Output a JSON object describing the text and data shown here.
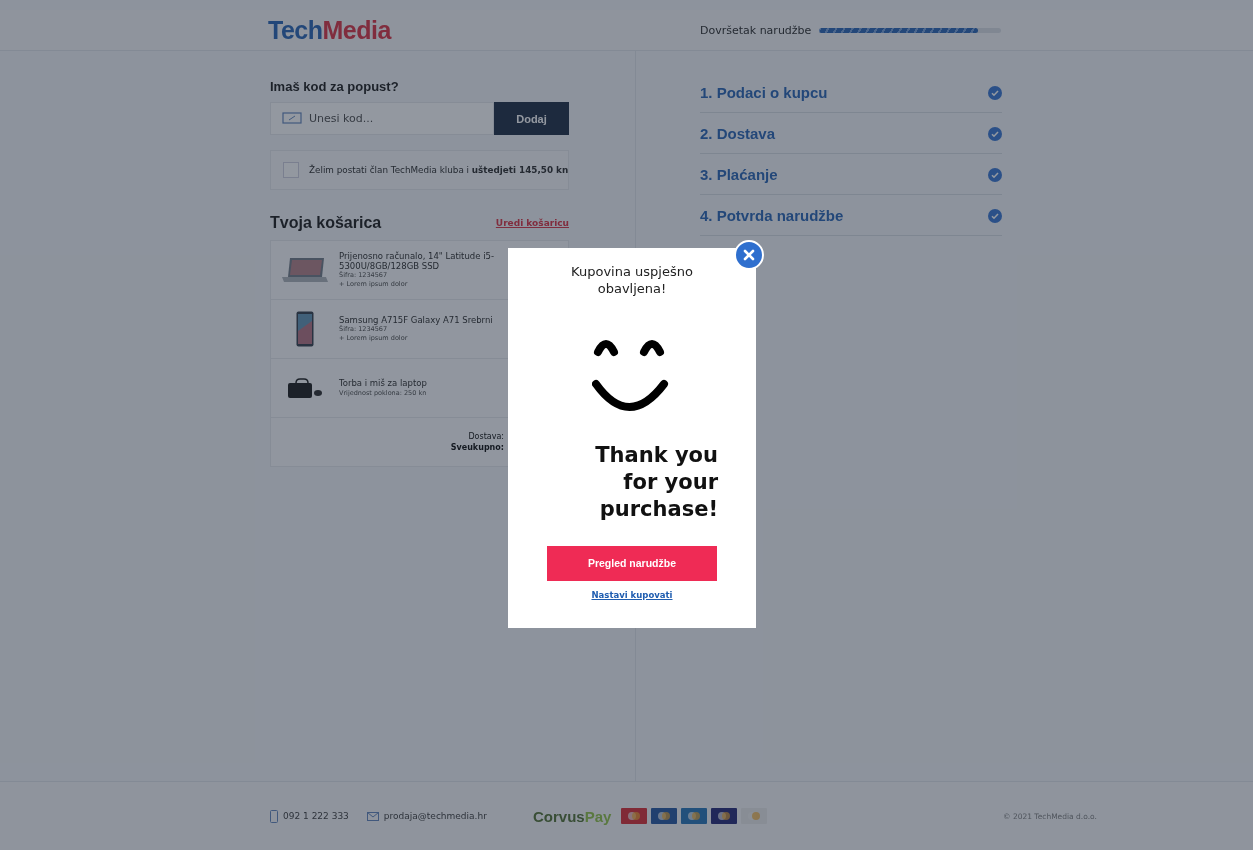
{
  "header": {
    "logo": [
      "Tech",
      "Media"
    ],
    "progress": {
      "label": "Dovršetak narudžbe",
      "level": 0.87
    }
  },
  "discount": {
    "title": "Imaš kod za popust?",
    "placeholder": "Unesi kod...",
    "button": "Dodaj"
  },
  "club": {
    "checked": false,
    "text": "Želim postati član TechMedia kluba i **uštedjeti 145,50 kn**"
  },
  "cart": {
    "title": "Tvoja košarica",
    "edit_link": "Uredi košaricu",
    "items": [
      {
        "kind": "laptop",
        "lines": [
          "Prijenosno računalo, 14\" Latitude i5-5300U/8GB/128GB SSD",
          "Šifra: 1234567",
          "+ Lorem ipsum dolor"
        ]
      },
      {
        "kind": "phone",
        "lines": [
          "Samsung A715F Galaxy A71 Srebrni",
          "Šifra: 1234567",
          "+ Lorem ipsum dolor"
        ]
      },
      {
        "kind": "bag",
        "lines": [
          "Torba i miš za laptop",
          "Vrijednost poklona: 250 kn"
        ]
      }
    ],
    "totals": [
      "Dostava:",
      "Sveukupno:"
    ]
  },
  "steps": [
    {
      "label": "1. Podaci o kupcu",
      "done": true
    },
    {
      "label": "2. Dostava",
      "done": true
    },
    {
      "label": "3. Plaćanje",
      "done": true
    },
    {
      "label": "4. Potvrda narudžbe",
      "done": true
    }
  ],
  "footer": {
    "phone": "092 1 222 333",
    "email": "prodaja@techmedia.hr",
    "payment_brand": [
      "Corvus",
      "Pay"
    ],
    "copyright": "© 2021 TechMedia d.o.o."
  },
  "modal": {
    "title": "Kupovina uspješno obavljena!",
    "message": [
      "Thank you",
      "for your",
      "purchase!"
    ],
    "button": "Pregled narudžbe",
    "link": "Nastavi kupovati"
  }
}
